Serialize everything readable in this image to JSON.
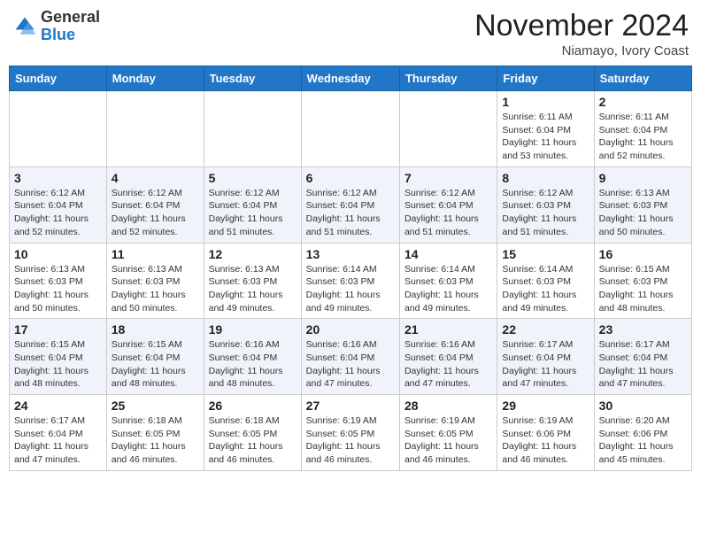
{
  "header": {
    "logo_general": "General",
    "logo_blue": "Blue",
    "month_title": "November 2024",
    "location": "Niamayo, Ivory Coast"
  },
  "days_of_week": [
    "Sunday",
    "Monday",
    "Tuesday",
    "Wednesday",
    "Thursday",
    "Friday",
    "Saturday"
  ],
  "weeks": [
    [
      {
        "day": "",
        "info": ""
      },
      {
        "day": "",
        "info": ""
      },
      {
        "day": "",
        "info": ""
      },
      {
        "day": "",
        "info": ""
      },
      {
        "day": "",
        "info": ""
      },
      {
        "day": "1",
        "info": "Sunrise: 6:11 AM\nSunset: 6:04 PM\nDaylight: 11 hours and 53 minutes."
      },
      {
        "day": "2",
        "info": "Sunrise: 6:11 AM\nSunset: 6:04 PM\nDaylight: 11 hours and 52 minutes."
      }
    ],
    [
      {
        "day": "3",
        "info": "Sunrise: 6:12 AM\nSunset: 6:04 PM\nDaylight: 11 hours and 52 minutes."
      },
      {
        "day": "4",
        "info": "Sunrise: 6:12 AM\nSunset: 6:04 PM\nDaylight: 11 hours and 52 minutes."
      },
      {
        "day": "5",
        "info": "Sunrise: 6:12 AM\nSunset: 6:04 PM\nDaylight: 11 hours and 51 minutes."
      },
      {
        "day": "6",
        "info": "Sunrise: 6:12 AM\nSunset: 6:04 PM\nDaylight: 11 hours and 51 minutes."
      },
      {
        "day": "7",
        "info": "Sunrise: 6:12 AM\nSunset: 6:04 PM\nDaylight: 11 hours and 51 minutes."
      },
      {
        "day": "8",
        "info": "Sunrise: 6:12 AM\nSunset: 6:03 PM\nDaylight: 11 hours and 51 minutes."
      },
      {
        "day": "9",
        "info": "Sunrise: 6:13 AM\nSunset: 6:03 PM\nDaylight: 11 hours and 50 minutes."
      }
    ],
    [
      {
        "day": "10",
        "info": "Sunrise: 6:13 AM\nSunset: 6:03 PM\nDaylight: 11 hours and 50 minutes."
      },
      {
        "day": "11",
        "info": "Sunrise: 6:13 AM\nSunset: 6:03 PM\nDaylight: 11 hours and 50 minutes."
      },
      {
        "day": "12",
        "info": "Sunrise: 6:13 AM\nSunset: 6:03 PM\nDaylight: 11 hours and 49 minutes."
      },
      {
        "day": "13",
        "info": "Sunrise: 6:14 AM\nSunset: 6:03 PM\nDaylight: 11 hours and 49 minutes."
      },
      {
        "day": "14",
        "info": "Sunrise: 6:14 AM\nSunset: 6:03 PM\nDaylight: 11 hours and 49 minutes."
      },
      {
        "day": "15",
        "info": "Sunrise: 6:14 AM\nSunset: 6:03 PM\nDaylight: 11 hours and 49 minutes."
      },
      {
        "day": "16",
        "info": "Sunrise: 6:15 AM\nSunset: 6:03 PM\nDaylight: 11 hours and 48 minutes."
      }
    ],
    [
      {
        "day": "17",
        "info": "Sunrise: 6:15 AM\nSunset: 6:04 PM\nDaylight: 11 hours and 48 minutes."
      },
      {
        "day": "18",
        "info": "Sunrise: 6:15 AM\nSunset: 6:04 PM\nDaylight: 11 hours and 48 minutes."
      },
      {
        "day": "19",
        "info": "Sunrise: 6:16 AM\nSunset: 6:04 PM\nDaylight: 11 hours and 48 minutes."
      },
      {
        "day": "20",
        "info": "Sunrise: 6:16 AM\nSunset: 6:04 PM\nDaylight: 11 hours and 47 minutes."
      },
      {
        "day": "21",
        "info": "Sunrise: 6:16 AM\nSunset: 6:04 PM\nDaylight: 11 hours and 47 minutes."
      },
      {
        "day": "22",
        "info": "Sunrise: 6:17 AM\nSunset: 6:04 PM\nDaylight: 11 hours and 47 minutes."
      },
      {
        "day": "23",
        "info": "Sunrise: 6:17 AM\nSunset: 6:04 PM\nDaylight: 11 hours and 47 minutes."
      }
    ],
    [
      {
        "day": "24",
        "info": "Sunrise: 6:17 AM\nSunset: 6:04 PM\nDaylight: 11 hours and 47 minutes."
      },
      {
        "day": "25",
        "info": "Sunrise: 6:18 AM\nSunset: 6:05 PM\nDaylight: 11 hours and 46 minutes."
      },
      {
        "day": "26",
        "info": "Sunrise: 6:18 AM\nSunset: 6:05 PM\nDaylight: 11 hours and 46 minutes."
      },
      {
        "day": "27",
        "info": "Sunrise: 6:19 AM\nSunset: 6:05 PM\nDaylight: 11 hours and 46 minutes."
      },
      {
        "day": "28",
        "info": "Sunrise: 6:19 AM\nSunset: 6:05 PM\nDaylight: 11 hours and 46 minutes."
      },
      {
        "day": "29",
        "info": "Sunrise: 6:19 AM\nSunset: 6:06 PM\nDaylight: 11 hours and 46 minutes."
      },
      {
        "day": "30",
        "info": "Sunrise: 6:20 AM\nSunset: 6:06 PM\nDaylight: 11 hours and 45 minutes."
      }
    ]
  ]
}
